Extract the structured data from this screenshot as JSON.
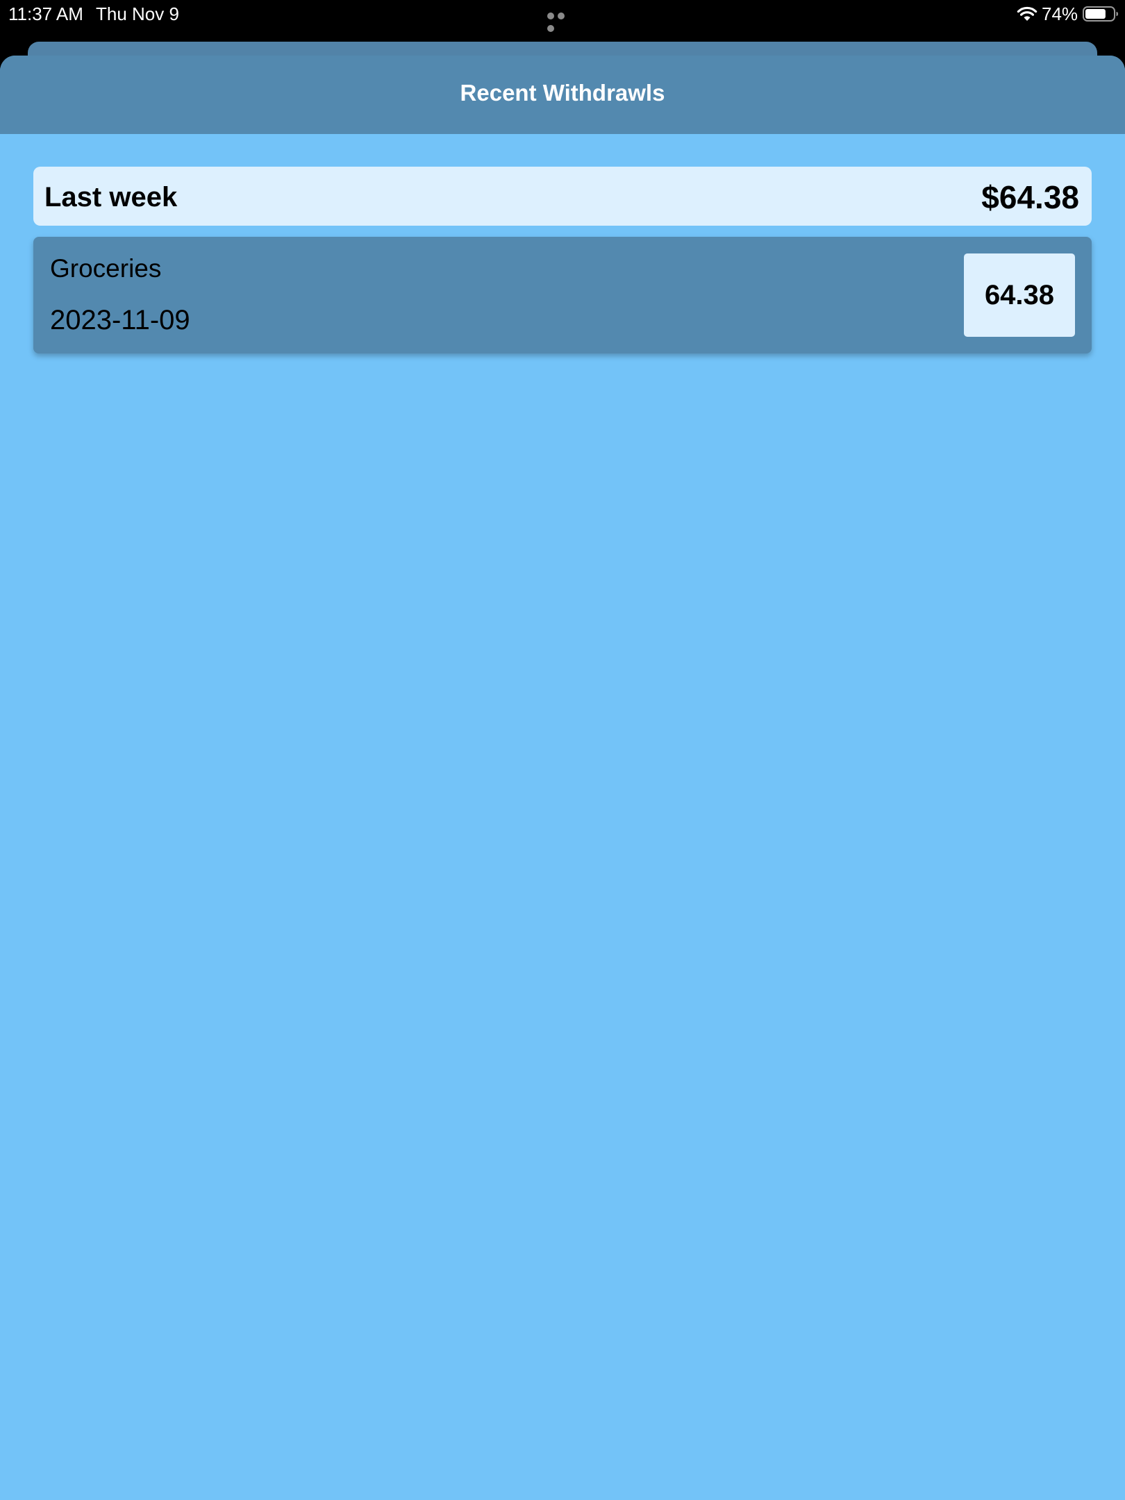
{
  "status_bar": {
    "time": "11:37 AM",
    "date": "Thu Nov 9",
    "battery_percent": "74%",
    "battery_level": 0.74,
    "icons": [
      "wifi-icon",
      "battery-icon",
      "multitask-dots-icon"
    ]
  },
  "header": {
    "title": "Recent Withdrawls"
  },
  "summary": {
    "label": "Last week",
    "amount": "$64.38"
  },
  "transactions": [
    {
      "category": "Groceries",
      "date": "2023-11-09",
      "amount": "64.38"
    }
  ],
  "colors": {
    "background": "#73c3f8",
    "header": "#5389af",
    "card": "#5389af",
    "light_panel": "#ddf0fe",
    "status_bar": "#000000"
  }
}
